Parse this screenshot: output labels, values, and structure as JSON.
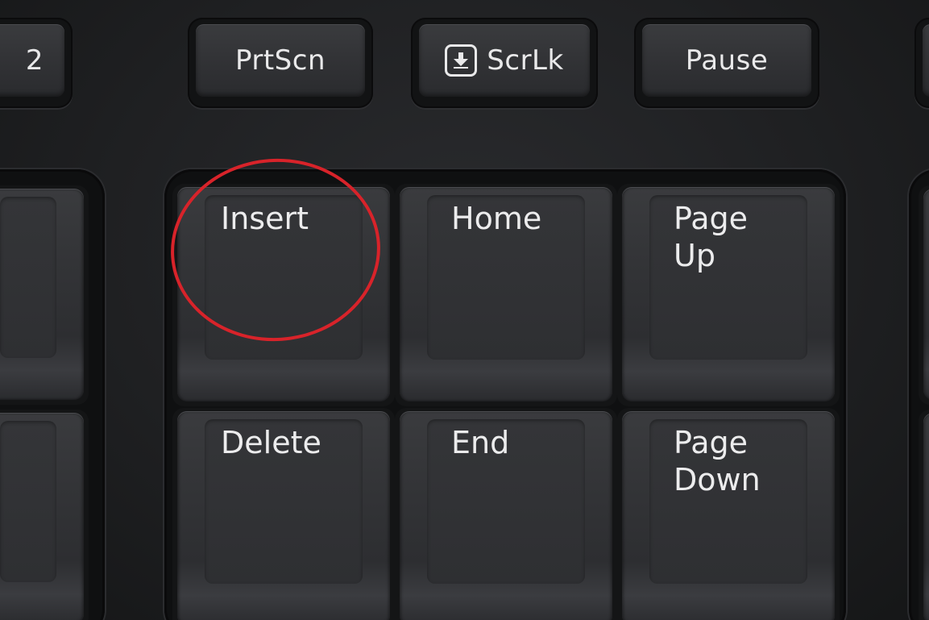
{
  "image": {
    "type": "keyboard-closeup-photo",
    "colors": {
      "key_body": "#303134",
      "key_label": "#ececed",
      "highlight": "#d8232a"
    }
  },
  "function_row": {
    "partial_left_label": "2",
    "prtscn": "PrtScn",
    "scrlk": "ScrLk",
    "scrlk_icon": "scroll-lock-arrow-icon",
    "pause": "Pause"
  },
  "navigation_cluster": {
    "insert": "Insert",
    "home": "Home",
    "page_up": "Page\nUp",
    "delete": "Delete",
    "end": "End",
    "page_down": "Page\nDown"
  },
  "annotation": {
    "shape": "ellipse",
    "color": "#d8232a",
    "target_key": "Insert"
  }
}
